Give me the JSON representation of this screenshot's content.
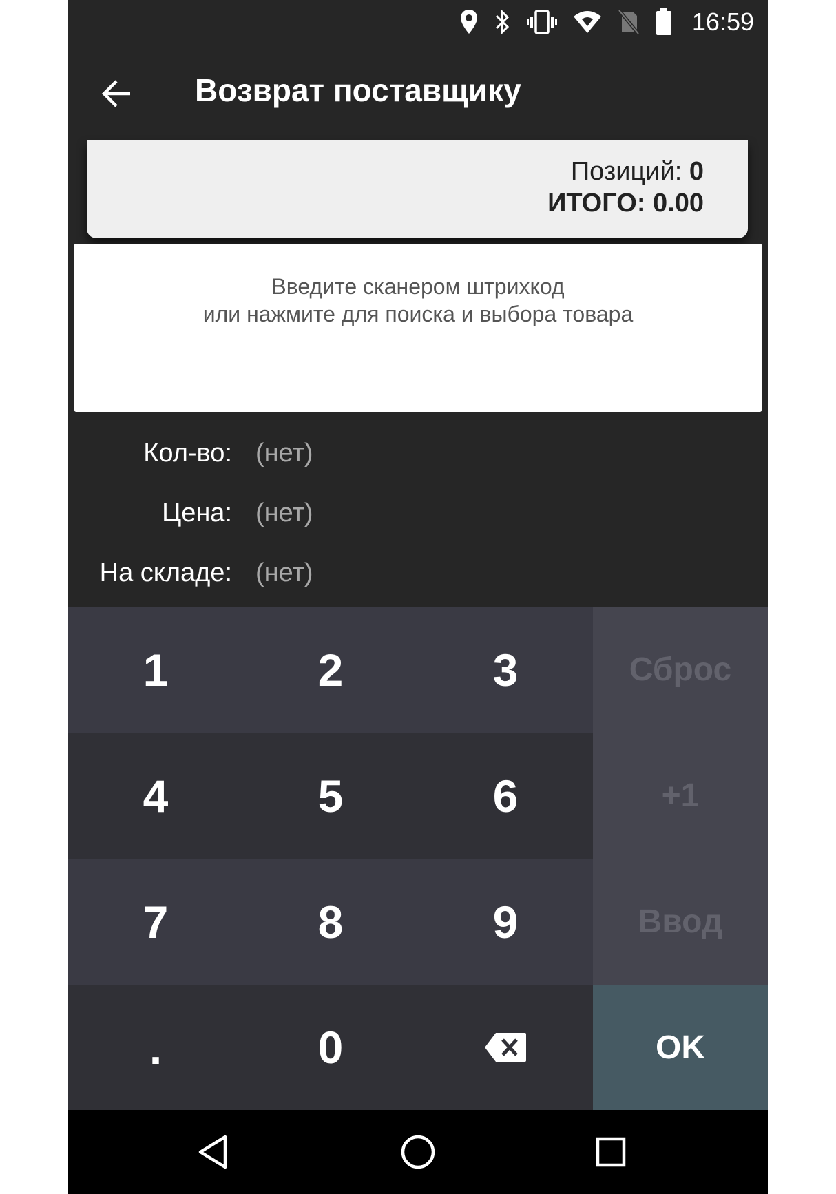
{
  "status_bar": {
    "time": "16:59",
    "icons": [
      "location-icon",
      "bluetooth-icon",
      "vibrate-icon",
      "wifi-icon",
      "no-sim-icon",
      "battery-icon"
    ]
  },
  "toolbar": {
    "title": "Возврат поставщику",
    "back_icon": "arrow-left-icon"
  },
  "summary": {
    "positions_label": "Позиций: ",
    "positions_value": "0",
    "total_label": "ИТОГО: ",
    "total_value": "0.00"
  },
  "search": {
    "line1": "Введите сканером штрихкод",
    "line2": "или нажмите для поиска и выбора товара"
  },
  "fields": [
    {
      "label": "Кол-во:",
      "value": "(нет)"
    },
    {
      "label": "Цена:",
      "value": "(нет)"
    },
    {
      "label": "На складе:",
      "value": "(нет)"
    }
  ],
  "keypad": {
    "keys": [
      "1",
      "2",
      "3",
      "4",
      "5",
      "6",
      "7",
      "8",
      "9",
      ".",
      "0"
    ],
    "backspace_icon": "backspace-icon",
    "reset": "Сброс",
    "plus_one": "+1",
    "enter": "Ввод",
    "ok": "OK"
  },
  "nav_bar": {
    "icons": [
      "back-triangle-icon",
      "home-circle-icon",
      "recents-square-icon"
    ]
  },
  "colors": {
    "background": "#262626",
    "card": "#efefef",
    "key_dark": "#303036",
    "key_mid": "#3a3a44",
    "key_side": "#45454f",
    "ok": "#465a63"
  }
}
